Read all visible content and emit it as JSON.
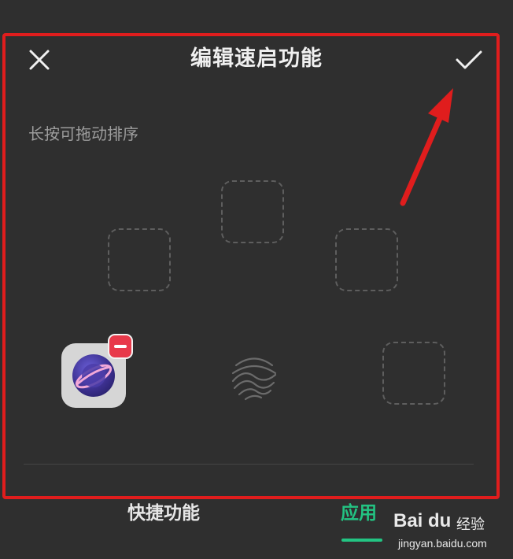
{
  "header": {
    "title": "编辑速启功能",
    "close_icon": "close-icon",
    "confirm_icon": "checkmark-icon"
  },
  "hint_text": "长按可拖动排序",
  "grid": {
    "slots": [
      "empty",
      "empty",
      "empty",
      "app",
      "fingerprint",
      "empty"
    ],
    "app_icon": "planet-browser-icon",
    "remove_badge_icon": "minus-icon"
  },
  "tabs": [
    {
      "label": "快捷功能",
      "active": false
    },
    {
      "label": "应用",
      "active": true
    }
  ],
  "colors": {
    "background": "#2f2f2f",
    "accent": "#23c483",
    "annotation": "#e01d1d",
    "badge": "#e8394a"
  },
  "watermark": {
    "logo": "Bai du",
    "text": "经验",
    "url": "jingyan.baidu.com"
  }
}
